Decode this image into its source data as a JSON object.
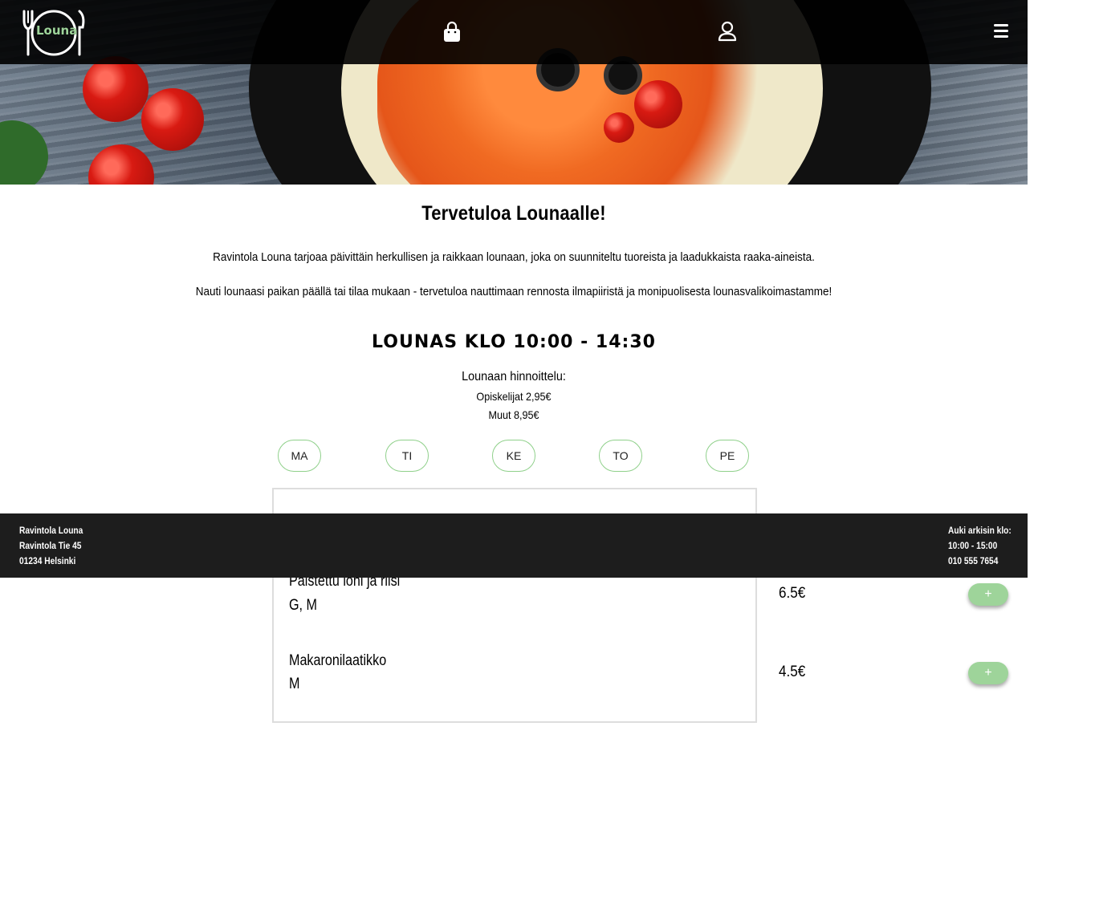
{
  "header": {
    "logo_text": "Louna",
    "cart_icon": "shopping-bag-icon",
    "user_icon": "user-icon",
    "menu_icon": "hamburger-menu-icon"
  },
  "intro": {
    "title": "Tervetuloa Lounaalle!",
    "paragraph1": "Ravintola Louna tarjoaa päivittäin herkullisen ja raikkaan lounaan, joka on suunniteltu tuoreista ja laadukkaista raaka-aineista.",
    "paragraph2": "Nauti lounaasi paikan päällä tai tilaa mukaan - tervetuloa nauttimaan rennosta ilmapiiristä ja monipuolisesta lounasvalikoimastamme!"
  },
  "lunch": {
    "title": "LOUNAS KLO 10:00 - 14:30",
    "pricing_heading": "Lounaan hinnoittelu:",
    "price_students": "Opiskelijat 2,95€",
    "price_others": "Muut 8,95€"
  },
  "days": [
    "MA",
    "TI",
    "KE",
    "TO",
    "PE"
  ],
  "menu": {
    "items": [
      {
        "name": "Paistettu lohi ja riisi",
        "tags": "G, M",
        "price": "6.5€",
        "add_label": "+"
      },
      {
        "name": "Makaronilaatikko",
        "tags": "M",
        "price": "4.5€",
        "add_label": "+"
      }
    ]
  },
  "footer": {
    "name": "Ravintola Louna",
    "street": "Ravintola Tie 45",
    "city": "01234 Helsinki",
    "hours_label": "Auki arkisin klo:",
    "hours": "10:00 - 15:00",
    "phone": "010 555 7654"
  },
  "colors": {
    "accent_green": "#9ed49a",
    "day_border": "#8fd08a",
    "footer_bg": "#1d1d1d",
    "header_bg": "#000000"
  }
}
